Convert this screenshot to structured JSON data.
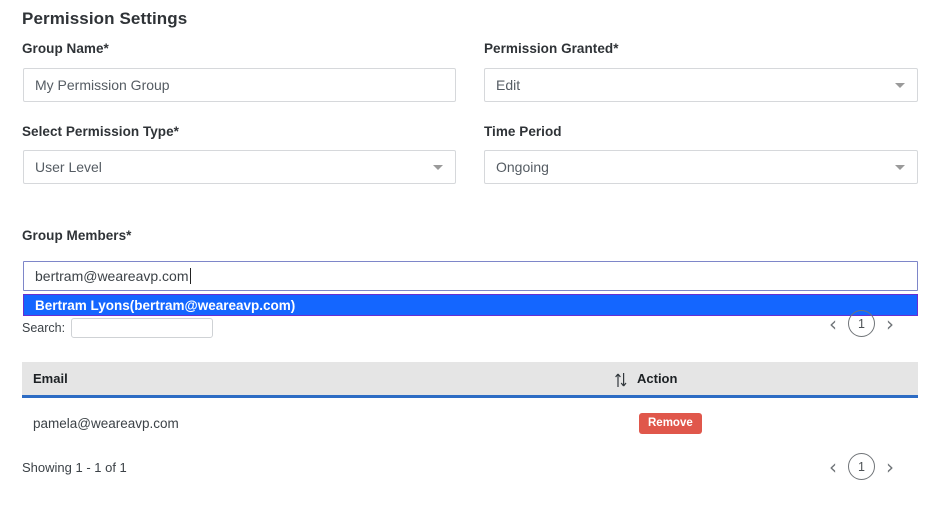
{
  "page_title": "Permission Settings",
  "colors": {
    "accent_blue": "#1466ff",
    "table_header_bg": "#e5e5e5",
    "table_header_border": "#2d6cc4",
    "remove_red": "#e0574b",
    "input_border": "#d6d8db",
    "focus_border": "#7e86c9"
  },
  "fields": {
    "group_name": {
      "label": "Group Name*",
      "value": "My Permission Group",
      "placeholder": ""
    },
    "permission_granted": {
      "label": "Permission Granted*",
      "value": "Edit",
      "caret": "chevron-down-icon"
    },
    "permission_type": {
      "label": "Select Permission Type*",
      "value": "User Level",
      "caret": "chevron-down-icon"
    },
    "time_period": {
      "label": "Time Period",
      "value": "Ongoing",
      "caret": "chevron-down-icon"
    },
    "group_members": {
      "label": "Group Members*",
      "value": "bertram@weareavp.com",
      "placeholder": "",
      "suggestions": [
        "Bertram Lyons(bertram@weareavp.com)"
      ]
    }
  },
  "search": {
    "label": "Search:",
    "value": "",
    "placeholder": ""
  },
  "pagination_top": {
    "prev_label": "‹",
    "page_label": "1",
    "next_label": "›"
  },
  "pagination_bottom": {
    "prev_label": "‹",
    "page_label": "1",
    "next_label": "›"
  },
  "members_table": {
    "columns": [
      "Email",
      "Action"
    ],
    "sort_icon": "sort-updown-icon",
    "rows": [
      {
        "email": "pamela@weareavp.com",
        "action_label": "Remove"
      }
    ],
    "showing_text": "Showing 1 - 1 of 1"
  }
}
